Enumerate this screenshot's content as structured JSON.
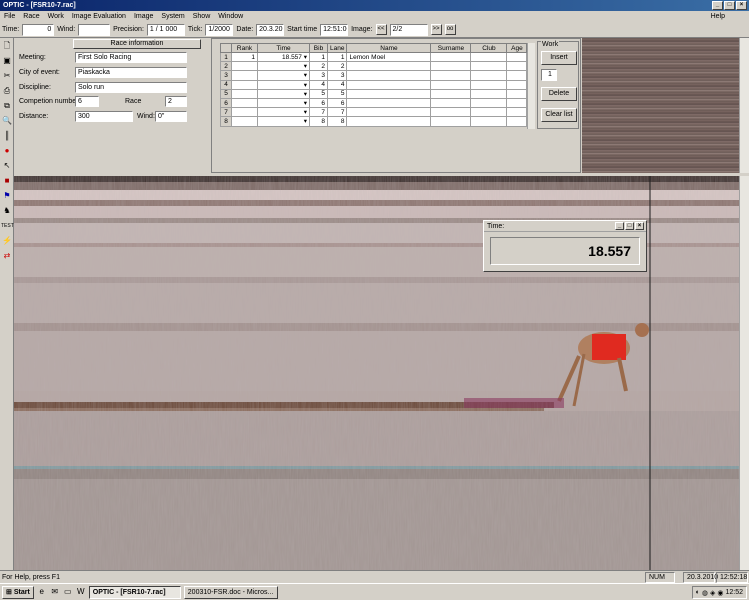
{
  "window": {
    "title": "OPTIC - [FSR10-7.rac]",
    "help": "Help"
  },
  "menu": [
    "File",
    "Race",
    "Work",
    "Image Evaluation",
    "Image",
    "System",
    "Show",
    "Window"
  ],
  "toolbar": {
    "time_label": "Time:",
    "time_value": "0",
    "wind_label": "Wind:",
    "wind_value": "",
    "precision_label": "Precision:",
    "precision_value": "1 / 1 000",
    "tick_label": "Tick:",
    "tick_value": "1/2000",
    "date_label": "Date:",
    "date_value": "20.3.201",
    "start_label": "Start time",
    "start_value": "12:51:06",
    "image_label": "Image:",
    "image_value": "2/2",
    "prev_btn": "<<",
    "next_btn": ">>",
    "last_btn": "oo"
  },
  "race_info": {
    "header": "Race information",
    "meeting_label": "Meeting:",
    "meeting": "First Solo Racing",
    "city_label": "City of event:",
    "city": "Piaskacka",
    "discipline_label": "Discipline:",
    "discipline": "Solo run",
    "comp_label": "Competion number:",
    "comp_number": "6",
    "race_label": "Race",
    "race": "2",
    "distance_label": "Distance:",
    "distance": "300",
    "wind_label": "Wind:",
    "wind": "0\""
  },
  "grid": {
    "columns": [
      "Rank",
      "Time",
      "Bib",
      "Lane",
      "Name",
      "Surname",
      "Club",
      "Age"
    ],
    "rows": [
      {
        "n": "1",
        "rank": "1",
        "time": "18.557",
        "bib": "1",
        "lane": "1",
        "name": "Lemon Moel"
      },
      {
        "n": "2",
        "rank": "",
        "time": "",
        "bib": "2",
        "lane": "2",
        "name": ""
      },
      {
        "n": "3",
        "rank": "",
        "time": "",
        "bib": "3",
        "lane": "3",
        "name": ""
      },
      {
        "n": "4",
        "rank": "",
        "time": "",
        "bib": "4",
        "lane": "4",
        "name": ""
      },
      {
        "n": "5",
        "rank": "",
        "time": "",
        "bib": "5",
        "lane": "5",
        "name": ""
      },
      {
        "n": "6",
        "rank": "",
        "time": "",
        "bib": "6",
        "lane": "6",
        "name": ""
      },
      {
        "n": "7",
        "rank": "",
        "time": "",
        "bib": "7",
        "lane": "7",
        "name": ""
      },
      {
        "n": "8",
        "rank": "",
        "time": "",
        "bib": "8",
        "lane": "8",
        "name": ""
      }
    ]
  },
  "work": {
    "title": "Work",
    "insert": "Insert",
    "spin": "1",
    "delete": "Delete",
    "clear": "Clear list"
  },
  "timebox": {
    "title": "Time:",
    "value": "18.557"
  },
  "status": {
    "help": "For Help, press F1",
    "num": "NUM",
    "date": "20.3.2010",
    "time": "12:52:18"
  },
  "taskbar": {
    "start": "Start",
    "item1": "OPTIC - [FSR10-7.rac]",
    "item2": "200310-FSR.doc - Micros...",
    "clock": "12:52"
  }
}
